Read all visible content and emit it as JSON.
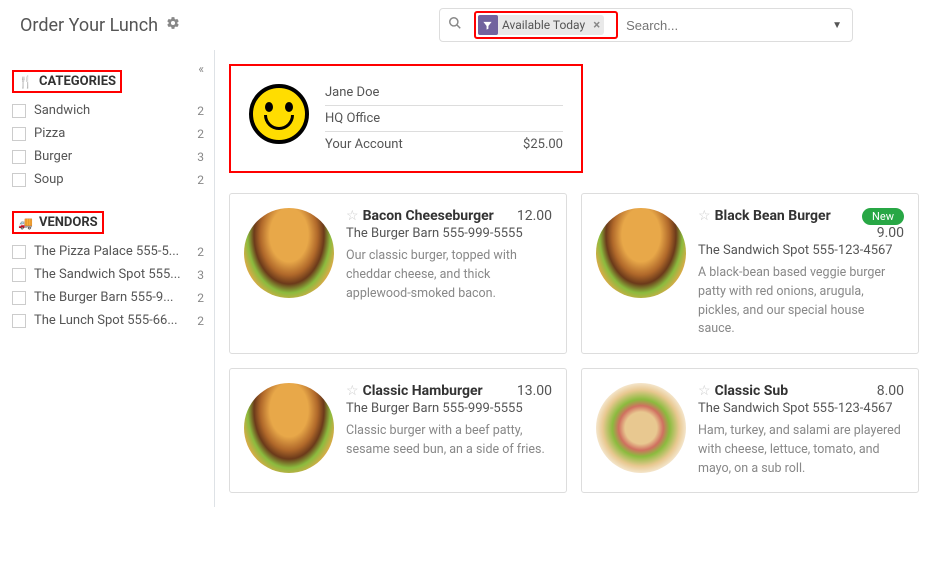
{
  "header": {
    "title": "Order Your Lunch",
    "filter_label": "Available Today",
    "search_placeholder": "Search..."
  },
  "sidebar": {
    "categories_title": "CATEGORIES",
    "categories": [
      {
        "label": "Sandwich",
        "count": "2"
      },
      {
        "label": "Pizza",
        "count": "2"
      },
      {
        "label": "Burger",
        "count": "3"
      },
      {
        "label": "Soup",
        "count": "2"
      }
    ],
    "vendors_title": "VENDORS",
    "vendors": [
      {
        "label": "The Pizza Palace 555-5...",
        "count": "2"
      },
      {
        "label": "The Sandwich Spot 555...",
        "count": "3"
      },
      {
        "label": "The Burger Barn 555-9...",
        "count": "2"
      },
      {
        "label": "The Lunch Spot 555-66...",
        "count": "2"
      }
    ]
  },
  "user": {
    "name": "Jane Doe",
    "location": "HQ Office",
    "account_label": "Your Account",
    "balance": "$25.00"
  },
  "products": [
    {
      "name": "Bacon Cheeseburger",
      "price": "12.00",
      "vendor": "The Burger Barn 555-999-5555",
      "desc": "Our classic burger, topped with cheddar cheese, and thick applewood-smoked bacon.",
      "img": "burger-img"
    },
    {
      "name": "Black Bean Burger",
      "price": "9.00",
      "vendor": "The Sandwich Spot 555-123-4567",
      "desc": "A black-bean based veggie burger patty with red onions, arugula, pickles, and our special house sauce.",
      "badge": "New",
      "img": "burger-img"
    },
    {
      "name": "Classic Hamburger",
      "price": "13.00",
      "vendor": "The Burger Barn 555-999-5555",
      "desc": "Classic burger with a beef patty, sesame seed bun, an a side of fries.",
      "img": "burger-img"
    },
    {
      "name": "Classic Sub",
      "price": "8.00",
      "vendor": "The Sandwich Spot 555-123-4567",
      "desc": "Ham, turkey, and salami are playered with cheese, lettuce, tomato, and mayo, on a sub roll.",
      "img": "sub-img"
    }
  ]
}
